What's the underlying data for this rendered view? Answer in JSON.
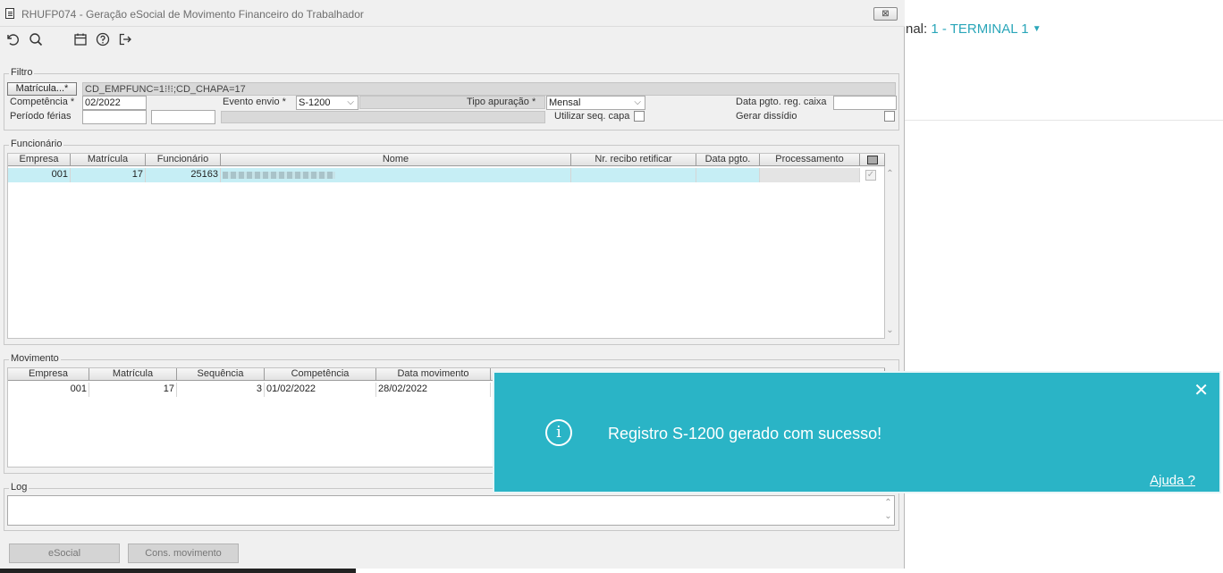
{
  "window": {
    "title": "RHUFP074 - Geração eSocial de Movimento Financeiro do Trabalhador",
    "close_label": "⊠"
  },
  "toolbar": {
    "icons": [
      "undo-icon",
      "search-icon",
      "calendar-icon",
      "help-icon",
      "exit-icon"
    ]
  },
  "background": {
    "terminal_prefix": "nal:",
    "terminal_value": "1 - TERMINAL 1"
  },
  "filtro": {
    "legend": "Filtro",
    "matricula_button": "Matrícula...*",
    "matricula_value": "CD_EMPFUNC=1⁝!⁝;CD_CHAPA=17",
    "competencia_label": "Competência *",
    "competencia_value": "02/2022",
    "evento_label": "Evento envio *",
    "evento_value": "S-1200",
    "tipo_label": "Tipo apuração *",
    "tipo_value": "Mensal",
    "data_pgto_label": "Data pgto. reg. caixa",
    "data_pgto_value": "",
    "periodo_label": "Período férias",
    "periodo_inicio": "",
    "periodo_fim": "",
    "utilizar_label": "Utilizar seq. capa",
    "gerar_label": "Gerar dissídio"
  },
  "funcionario": {
    "legend": "Funcionário",
    "columns": [
      "Empresa",
      "Matrícula",
      "Funcionário",
      "Nome",
      "Nr. recibo retificar",
      "Data pgto.",
      "Processamento"
    ],
    "rows": [
      {
        "empresa": "001",
        "matricula": "17",
        "funcionario": "25163",
        "nome": "",
        "recibo": "",
        "data_pgto": "",
        "processamento": ""
      }
    ]
  },
  "movimento": {
    "legend": "Movimento",
    "columns": [
      "Empresa",
      "Matrícula",
      "Sequência",
      "Competência",
      "Data movimento"
    ],
    "rows": [
      {
        "empresa": "001",
        "matricula": "17",
        "sequencia": "3",
        "competencia": "01/02/2022",
        "data_movimento": "28/02/2022"
      }
    ]
  },
  "log": {
    "legend": "Log",
    "text": ""
  },
  "buttons": {
    "esocial": "eSocial",
    "cons_movimento": "Cons. movimento"
  },
  "toast": {
    "message": "Registro S-1200 gerado com sucesso!",
    "help": "Ajuda ?",
    "close": "✕",
    "color": "#2ab4c6"
  }
}
